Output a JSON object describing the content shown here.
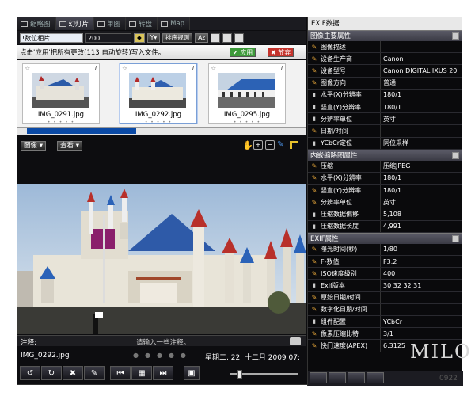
{
  "tabs": [
    {
      "label": "缩略图"
    },
    {
      "label": "幻灯片"
    },
    {
      "label": "单图"
    },
    {
      "label": "转盘"
    },
    {
      "label": "Map"
    }
  ],
  "toolbar": {
    "folder_value": "!数位相片 ",
    "year_value": "200",
    "sort_label": "排序规则",
    "sort_value": "Az"
  },
  "notice": {
    "text": "点击'应用'把所有更改(113 自动旋转)写入文件。",
    "apply_label": "应用",
    "discard_label": "放弃"
  },
  "thumbs": [
    {
      "name": "IMG_0291.jpg",
      "stars": "• • • • •"
    },
    {
      "name": "IMG_0292.jpg",
      "stars": "• • • • •"
    },
    {
      "name": "IMG_0295.jpg",
      "stars": "• • • • •"
    }
  ],
  "viewbar": {
    "image_menu": "图像",
    "view_menu": "查看"
  },
  "comment": {
    "label": "注释:",
    "placeholder": "请输入一些注释。"
  },
  "infobar": {
    "filename": "IMG_0292.jpg",
    "datetime": "星期二, 22. 十二月 2009 07:"
  },
  "exif": {
    "title": "EXIF数据",
    "section1": "图像主要属性",
    "rows1": [
      {
        "k": "图像描述",
        "v": "",
        "icon": "pen"
      },
      {
        "k": "设备生产商",
        "v": "Canon",
        "icon": "pen"
      },
      {
        "k": "设备型号",
        "v": "Canon DIGITAL IXUS 20",
        "icon": "pen"
      },
      {
        "k": "图像方向",
        "v": "普通",
        "icon": "pen"
      },
      {
        "k": "水平(X)分辨率",
        "v": "180/1",
        "icon": "lock"
      },
      {
        "k": "竖直(Y)分辨率",
        "v": "180/1",
        "icon": "lock"
      },
      {
        "k": "分辨率单位",
        "v": "英寸",
        "icon": "lock"
      },
      {
        "k": "日期/时间",
        "v": "",
        "icon": "pen"
      },
      {
        "k": "YCbCr定位",
        "v": "同位采样",
        "icon": "lock"
      }
    ],
    "section2": "内嵌缩略图属性",
    "rows2": [
      {
        "k": "压缩",
        "v": "压缩JPEG",
        "icon": "pen"
      },
      {
        "k": "水平(X)分辨率",
        "v": "180/1",
        "icon": "pen"
      },
      {
        "k": "竖直(Y)分辨率",
        "v": "180/1",
        "icon": "pen"
      },
      {
        "k": "分辨率单位",
        "v": "英寸",
        "icon": "pen"
      },
      {
        "k": "压缩数据偏移",
        "v": "5,108",
        "icon": "lock"
      },
      {
        "k": "压缩数据长度",
        "v": "4,991",
        "icon": "lock"
      }
    ],
    "section3": "EXIF属性",
    "rows3": [
      {
        "k": "曝光时间(秒)",
        "v": "1/80",
        "icon": "pen"
      },
      {
        "k": "F-数值",
        "v": "F3.2",
        "icon": "pen"
      },
      {
        "k": "ISO速度级别",
        "v": "400",
        "icon": "pen"
      },
      {
        "k": "Exif版本",
        "v": "30 32 32 31",
        "icon": "lock"
      },
      {
        "k": "原始日期/时间",
        "v": "",
        "icon": "pen"
      },
      {
        "k": "数字化日期/时间",
        "v": "",
        "icon": "pen"
      },
      {
        "k": "组件配置",
        "v": "YCbCr",
        "icon": "lock"
      },
      {
        "k": "像素压缩比特",
        "v": "3/1",
        "icon": "pen"
      },
      {
        "k": "快门速度(APEX)",
        "v": "6.3125",
        "icon": "pen"
      }
    ]
  },
  "watermark": {
    "text": "MILO",
    "sub": "0922"
  }
}
